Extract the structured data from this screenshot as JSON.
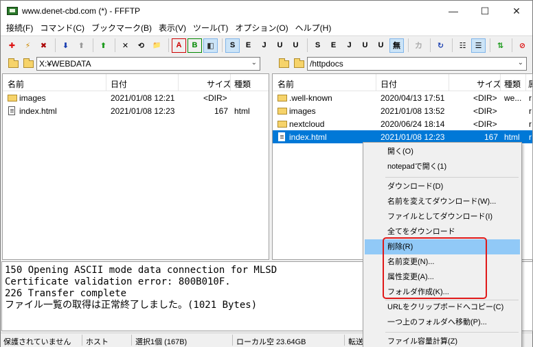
{
  "window": {
    "title": "www.denet-cbd.com (*) - FFFTP",
    "min": "—",
    "max": "☐",
    "close": "✕"
  },
  "menu": [
    "接続(F)",
    "コマンド(C)",
    "ブックマーク(B)",
    "表示(V)",
    "ツール(T)",
    "オプション(O)",
    "ヘルプ(H)"
  ],
  "toolbar": {
    "icons": [
      "connect-icon",
      "quick-connect-icon",
      "disconnect-icon",
      "download-icon",
      "upload-icon",
      "mirror-upload-icon",
      "delete-icon",
      "rename-icon",
      "mkdir-icon",
      "ascii-mode-icon",
      "binary-mode-icon",
      "auto-mode-icon",
      "sjis-icon",
      "euc-icon",
      "jis-icon",
      "utf8-icon",
      "utf8bom-icon",
      "sjis-icon",
      "euc-icon",
      "jis-icon",
      "utf8-icon",
      "utf8bom-icon",
      "no-convert-icon",
      "kana-icon",
      "refresh-icon",
      "list-view-icon",
      "detail-view-icon",
      "sync-icon",
      "stop-icon"
    ],
    "labels": [
      "✚",
      "⚡",
      "✖",
      "⬇",
      "⬆",
      "⬆",
      "✕",
      "⟲",
      "📁",
      "A",
      "B",
      "◧",
      "S",
      "E",
      "J",
      "U",
      "U",
      "S",
      "E",
      "J",
      "U",
      "U",
      "無",
      "カ",
      "↻",
      "☷",
      "☰",
      "⇅",
      "⊘"
    ]
  },
  "local": {
    "path": "X:¥WEBDATA",
    "headers": {
      "name": "名前",
      "date": "日付",
      "size": "サイズ",
      "type": "種類"
    },
    "rows": [
      {
        "name": "images",
        "date": "2021/01/08 12:21",
        "size": "<DIR>",
        "type": "",
        "kind": "folder"
      },
      {
        "name": "index.html",
        "date": "2021/01/08 12:23",
        "size": "167",
        "type": "html",
        "kind": "file"
      }
    ]
  },
  "remote": {
    "path": "/httpdocs",
    "headers": {
      "name": "名前",
      "date": "日付",
      "size": "サイズ",
      "type": "種類",
      "extra": "属"
    },
    "rows": [
      {
        "name": ".well-known",
        "date": "2020/04/13 17:51",
        "size": "<DIR>",
        "type": "we...",
        "extra": "r",
        "kind": "folder"
      },
      {
        "name": "images",
        "date": "2021/01/08 13:52",
        "size": "<DIR>",
        "type": "",
        "extra": "r",
        "kind": "folder"
      },
      {
        "name": "nextcloud",
        "date": "2020/06/24 18:14",
        "size": "<DIR>",
        "type": "",
        "extra": "r",
        "kind": "folder"
      },
      {
        "name": "index.html",
        "date": "2021/01/08 12:23",
        "size": "167",
        "type": "html",
        "extra": "r",
        "kind": "file"
      }
    ]
  },
  "log": [
    "150 Opening ASCII mode data connection for MLSD",
    "Certificate validation error: 800B010F.",
    "226 Transfer complete",
    "ファイル一覧の取得は正常終了しました。(1021 Bytes)"
  ],
  "status": {
    "security": "保護されていません",
    "host": "ホスト",
    "selection": "選択1個 (167B)",
    "local_free": "ローカル空 23.64GB",
    "transfer": "転送"
  },
  "context_menu": {
    "items": [
      "開く(O)",
      "notepadで開く(1)",
      "ダウンロード(D)",
      "名前を変えてダウンロード(W)...",
      "ファイルとしてダウンロード(I)",
      "全てをダウンロード",
      "削除(R)",
      "名前変更(N)...",
      "属性変更(A)...",
      "フォルダ作成(K)...",
      "URLをクリップボードへコピー(C)",
      "一つ上のフォルダへ移動(P)...",
      "ファイル容量計算(Z)"
    ],
    "highlighted": "削除(R)"
  },
  "colors": {
    "selection": "#0078d7",
    "menu_highlight": "#91c9f7",
    "annotation": "#e01818"
  }
}
